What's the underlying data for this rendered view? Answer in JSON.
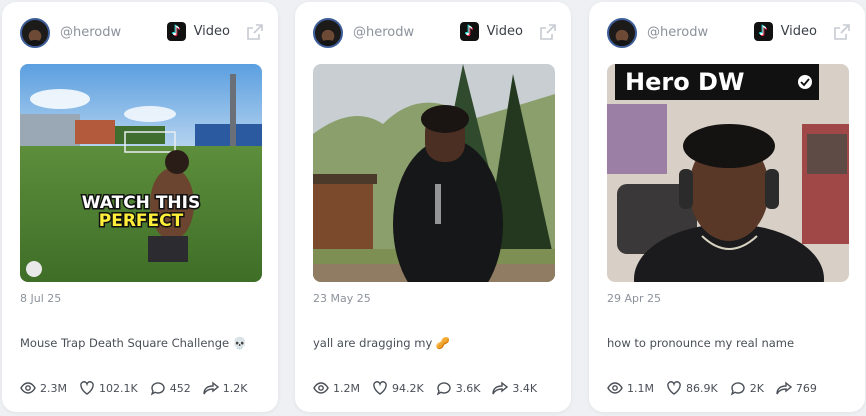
{
  "cards": [
    {
      "handle": "@herodw",
      "platform": "Video",
      "thumbnail_overlay": [
        "WATCH THIS",
        "PERFECT"
      ],
      "date": "8 Jul 25",
      "caption": "Mouse Trap Death Square Challenge 💀",
      "views": "2.3M",
      "likes": "102.1K",
      "comments": "452",
      "shares": "1.2K"
    },
    {
      "handle": "@herodw",
      "platform": "Video",
      "date": "23 May 25",
      "caption": "yall are dragging my 🥜",
      "views": "1.2M",
      "likes": "94.2K",
      "comments": "3.6K",
      "shares": "3.4K"
    },
    {
      "handle": "@herodw",
      "platform": "Video",
      "thumbnail_overlay": [
        "Hero DW"
      ],
      "date": "29 Apr 25",
      "caption": "how to pronounce my real name",
      "views": "1.1M",
      "likes": "86.9K",
      "comments": "2K",
      "shares": "769"
    }
  ],
  "icons": {
    "platform": "tiktok-icon",
    "external": "external-link-icon",
    "views": "eye-icon",
    "likes": "heart-icon",
    "comments": "comment-icon",
    "shares": "share-icon"
  },
  "colors": {
    "background": "#eef0f3",
    "card": "#ffffff",
    "muted_text": "#8c929c",
    "text": "#4a4f57"
  }
}
